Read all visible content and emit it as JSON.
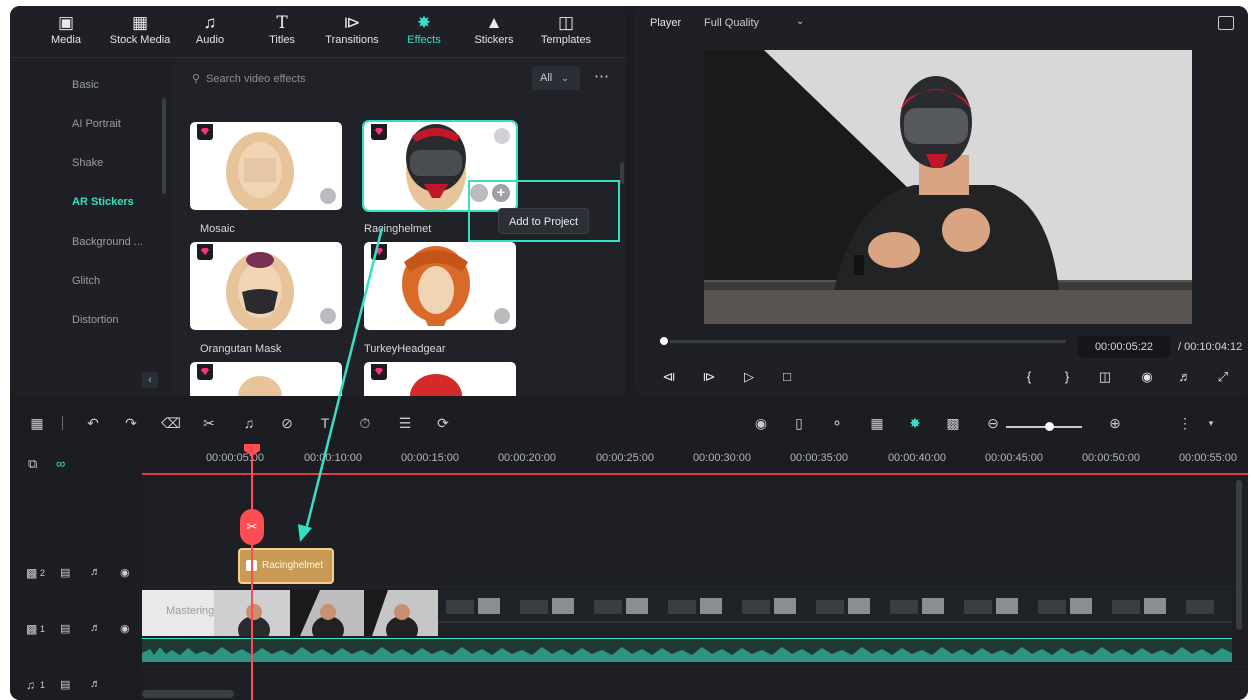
{
  "toolbar": {
    "items": [
      {
        "label": "Media",
        "icon": "media-icon"
      },
      {
        "label": "Stock Media",
        "icon": "stock-media-icon"
      },
      {
        "label": "Audio",
        "icon": "music-note-icon"
      },
      {
        "label": "Titles",
        "icon": "titles-icon"
      },
      {
        "label": "Transitions",
        "icon": "transitions-icon"
      },
      {
        "label": "Effects",
        "icon": "effects-icon"
      },
      {
        "label": "Stickers",
        "icon": "stickers-icon"
      },
      {
        "label": "Templates",
        "icon": "templates-icon"
      }
    ],
    "active": "Effects"
  },
  "sidebar": {
    "items": [
      {
        "label": "Basic"
      },
      {
        "label": "AI Portrait"
      },
      {
        "label": "Shake"
      },
      {
        "label": "AR Stickers"
      },
      {
        "label": "Background ..."
      },
      {
        "label": "Glitch"
      },
      {
        "label": "Distortion"
      }
    ],
    "active": "AR Stickers"
  },
  "search": {
    "placeholder": "Search video effects",
    "filter": "All"
  },
  "effects": {
    "cards": [
      {
        "label": "Mosaic"
      },
      {
        "label": "Racinghelmet"
      },
      {
        "label": "Orangutan Mask"
      },
      {
        "label": "TurkeyHeadgear"
      }
    ],
    "tooltip": "Add to Project"
  },
  "player": {
    "label": "Player",
    "quality": "Full Quality",
    "current_time": "00:00:05:22",
    "total_time": "/ 00:10:04:12"
  },
  "timeline": {
    "ruler": [
      "00:00:05:00",
      "00:00:10:00",
      "00:00:15:00",
      "00:00:20:00",
      "00:00:25:00",
      "00:00:30:00",
      "00:00:35:00",
      "00:00:40:00",
      "00:00:45:00",
      "00:00:50:00",
      "00:00:55:00"
    ],
    "sticker_clip": "Racinghelmet",
    "video_clip": "Mastering",
    "tracks": [
      {
        "number": "2",
        "type": "video"
      },
      {
        "number": "1",
        "type": "video"
      },
      {
        "number": "1",
        "type": "audio"
      }
    ]
  },
  "colors": {
    "accent": "#38e0c3",
    "playhead": "#ff4d54",
    "sticker_clip": "#c89a55"
  }
}
